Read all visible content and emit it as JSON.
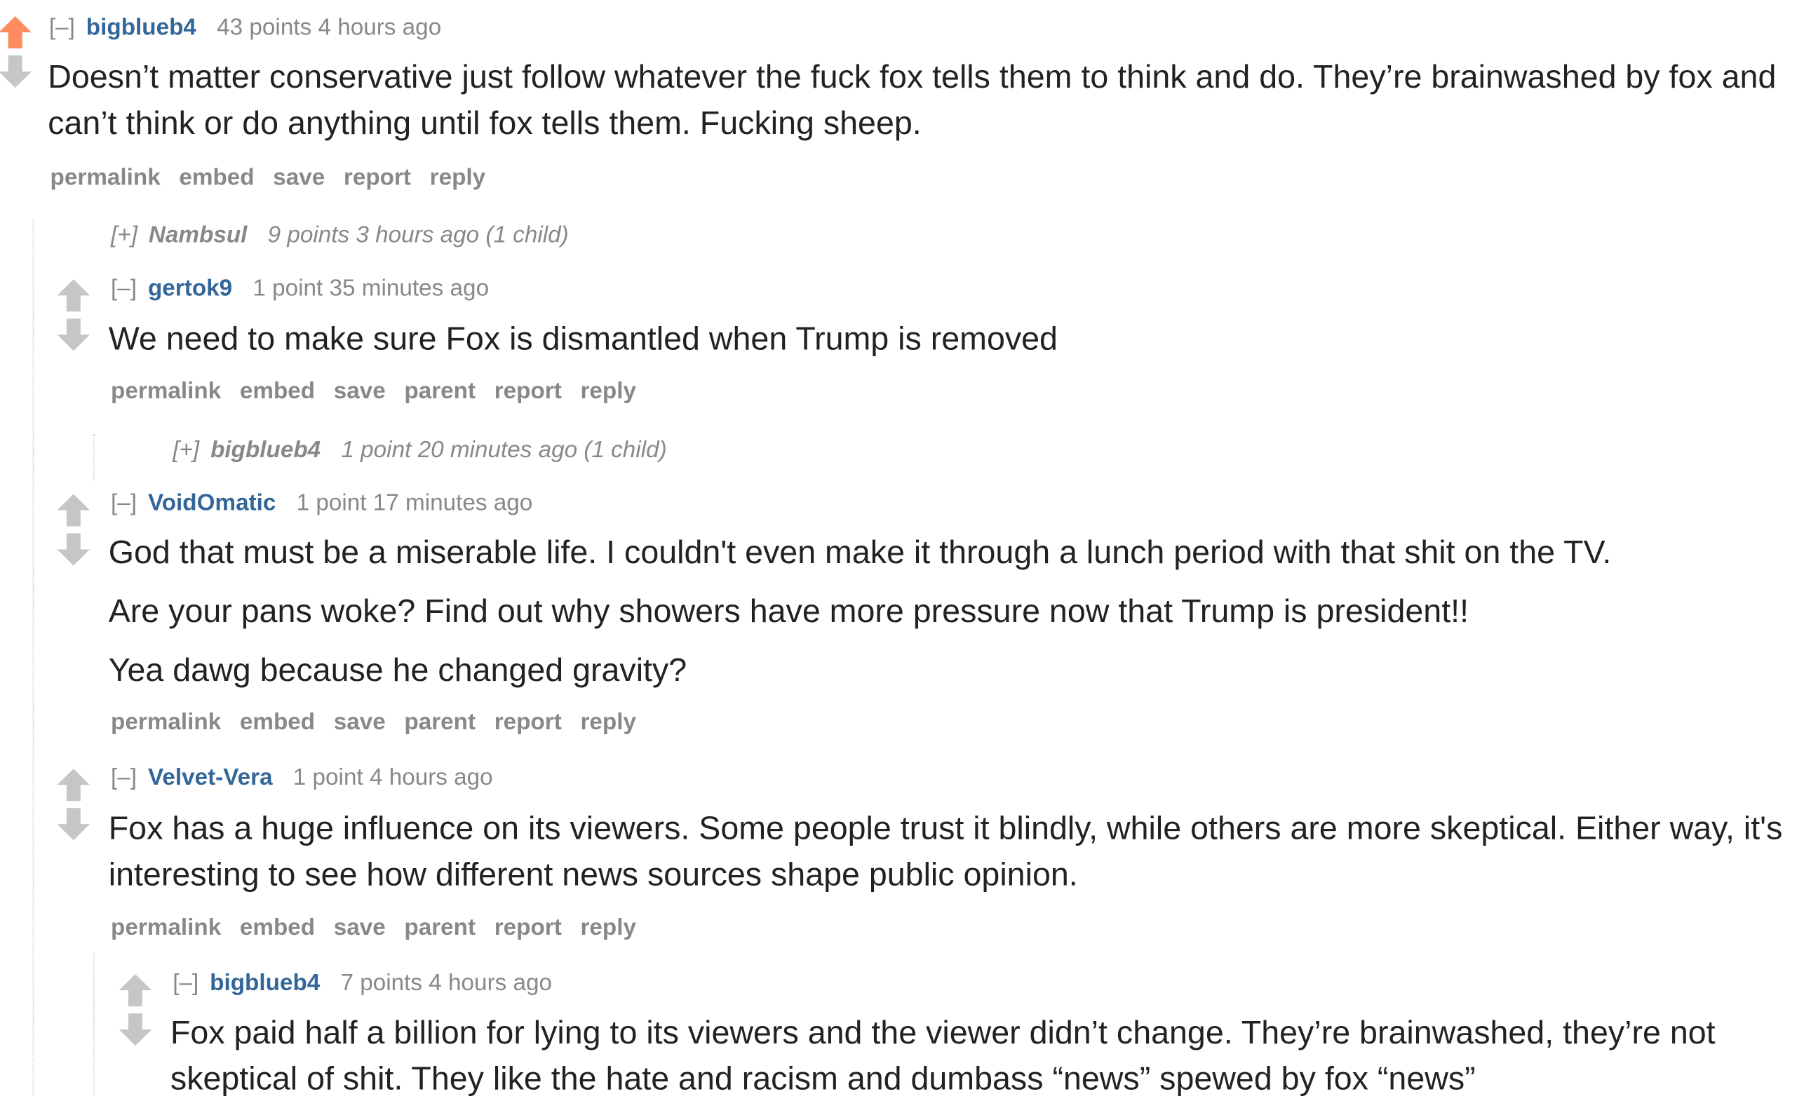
{
  "colors": {
    "upvote_active": "#ff8b60",
    "vote_inactive": "#c6c6c6",
    "author": "#336699",
    "meta": "#888888",
    "text": "#222222"
  },
  "comments": [
    {
      "expand": "[–]",
      "author": "bigblueb4",
      "meta": "43 points 4 hours ago",
      "paragraphs": [
        "Doesn’t matter conservative just follow whatever the fuck fox tells them to think and do. They’re brainwashed by fox and can’t think or do anything until fox tells them. Fucking sheep."
      ],
      "buttons": [
        "permalink",
        "embed",
        "save",
        "report",
        "reply"
      ],
      "upvoted": true
    },
    {
      "expand": "[+]",
      "author": "Nambsul",
      "meta": "9 points 3 hours ago (1 child)",
      "collapsed": true
    },
    {
      "expand": "[–]",
      "author": "gertok9",
      "meta": "1 point 35 minutes ago",
      "paragraphs": [
        "We need to make sure Fox is dismantled when Trump is removed"
      ],
      "buttons": [
        "permalink",
        "embed",
        "save",
        "parent",
        "report",
        "reply"
      ]
    },
    {
      "expand": "[+]",
      "author": "bigblueb4",
      "meta": "1 point 20 minutes ago (1 child)",
      "collapsed": true
    },
    {
      "expand": "[–]",
      "author": "VoidOmatic",
      "meta": "1 point 17 minutes ago",
      "paragraphs": [
        "God that must be a miserable life. I couldn't even make it through a lunch period with that shit on the TV.",
        "Are your pans woke? Find out why showers have more pressure now that Trump is president!!",
        "Yea dawg because he changed gravity?"
      ],
      "buttons": [
        "permalink",
        "embed",
        "save",
        "parent",
        "report",
        "reply"
      ]
    },
    {
      "expand": "[–]",
      "author": "Velvet-Vera",
      "meta": "1 point 4 hours ago",
      "paragraphs": [
        "Fox has a huge influence on its viewers. Some people trust it blindly, while others are more skeptical. Either way, it's interesting to see how different news sources shape public opinion."
      ],
      "buttons": [
        "permalink",
        "embed",
        "save",
        "parent",
        "report",
        "reply"
      ]
    },
    {
      "expand": "[–]",
      "author": "bigblueb4",
      "meta": "7 points 4 hours ago",
      "paragraphs": [
        "Fox paid half a billion for lying to its viewers and the viewer didn’t change. They’re brainwashed, they’re not skeptical of shit. They like the hate and racism and dumbass “news” spewed by fox “news”"
      ]
    }
  ]
}
